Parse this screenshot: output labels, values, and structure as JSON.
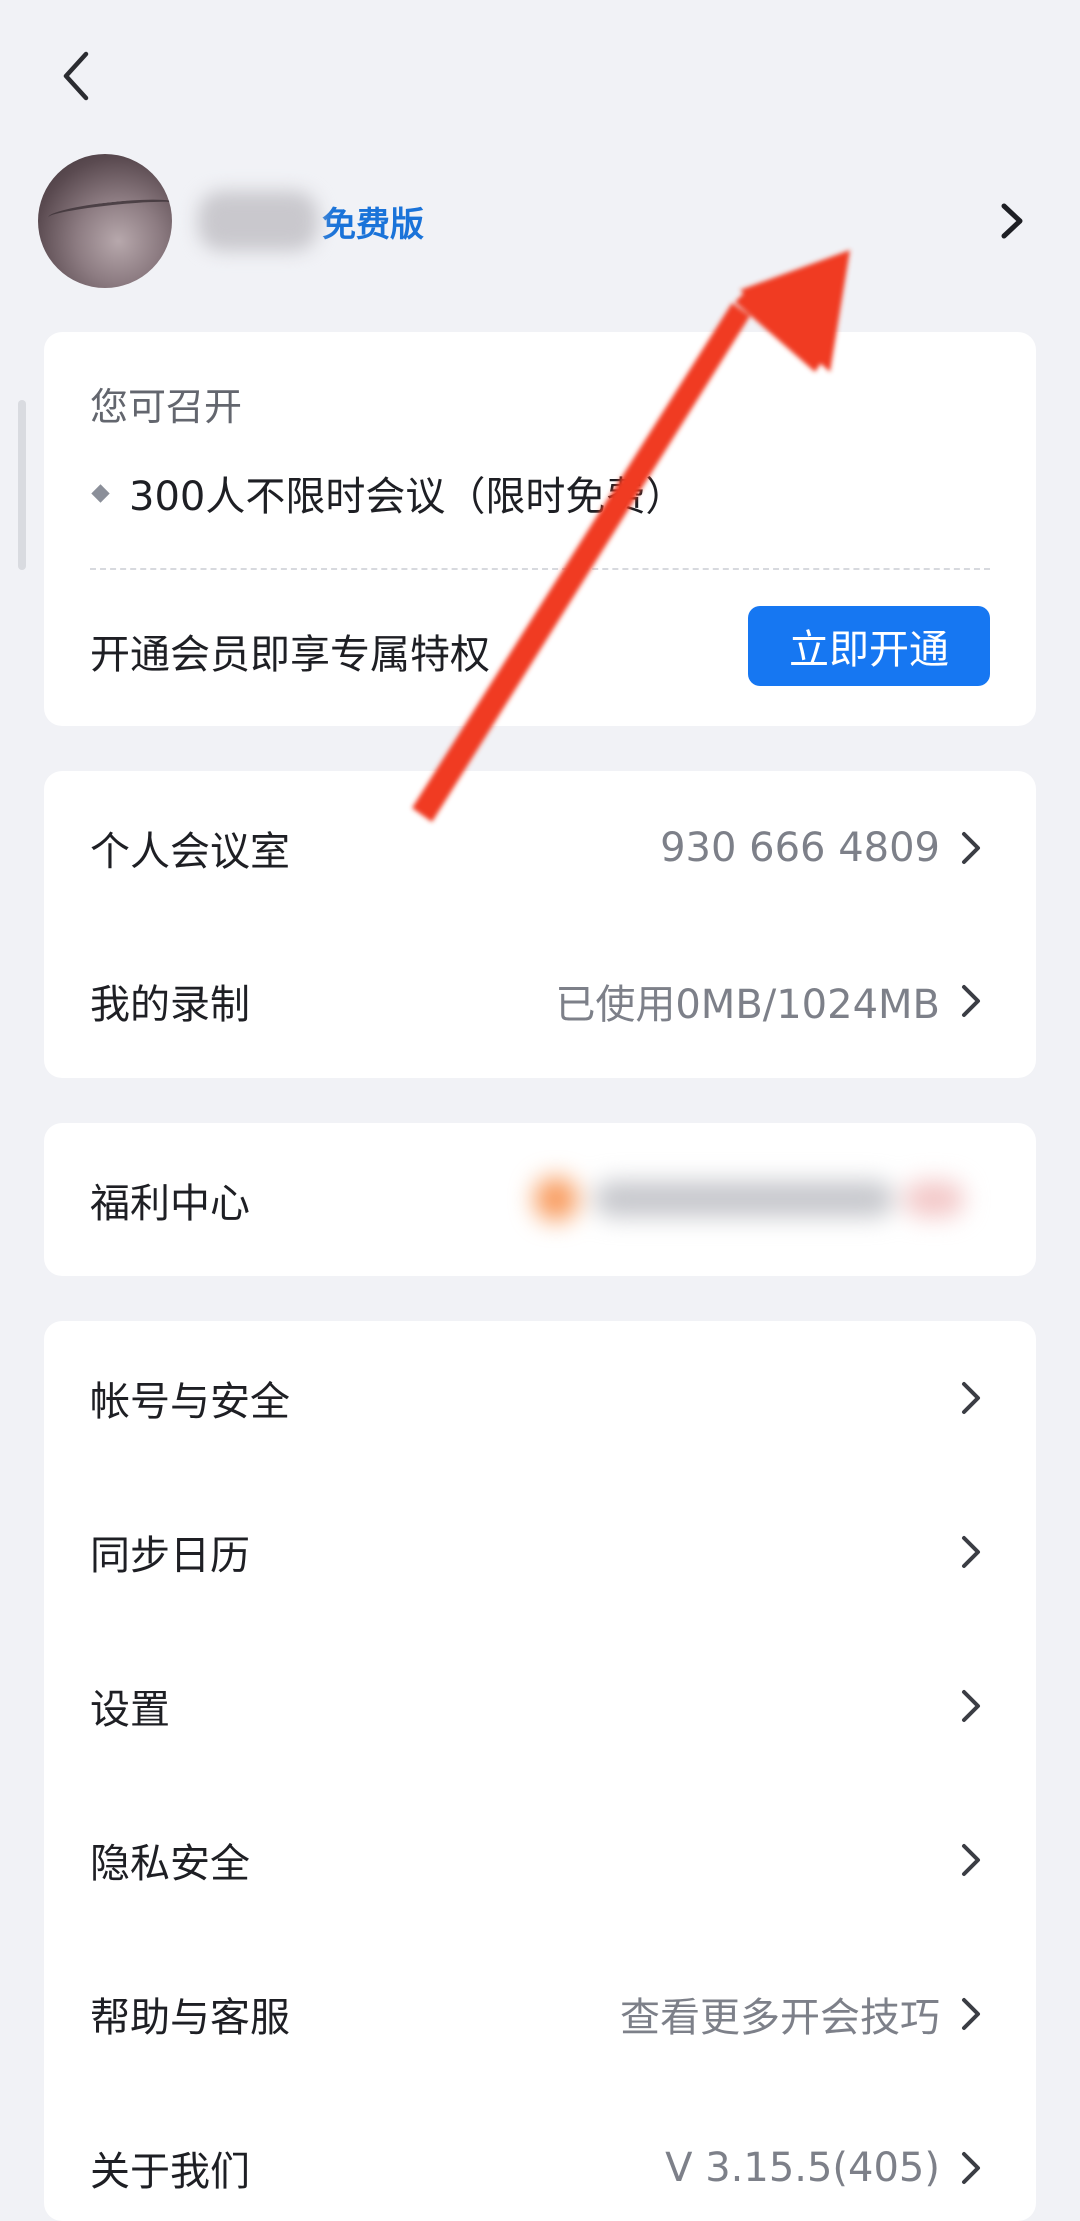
{
  "profile": {
    "username": "用户",
    "plan": "免费版"
  },
  "membership": {
    "label": "您可召开",
    "benefit": "300人不限时会议（限时免费）",
    "promo": "开通会员即享专属特权",
    "button": "立即开通"
  },
  "meeting_rows": [
    {
      "label": "个人会议室",
      "value": "930 666 4809"
    },
    {
      "label": "我的录制",
      "value": "已使用0MB/1024MB"
    }
  ],
  "welfare": {
    "label": "福利中心"
  },
  "settings_rows": [
    {
      "label": "帐号与安全",
      "value": ""
    },
    {
      "label": "同步日历",
      "value": ""
    },
    {
      "label": "设置",
      "value": ""
    },
    {
      "label": "隐私安全",
      "value": ""
    },
    {
      "label": "帮助与客服",
      "value": "查看更多开会技巧"
    },
    {
      "label": "关于我们",
      "value": "V 3.15.5(405)"
    }
  ],
  "icons": {
    "back": "chevron-left-icon",
    "row_chevron": "chevron-right-icon",
    "annotation": "red-arrow-annotation"
  },
  "colors": {
    "accent": "#1677f2",
    "plan_badge": "#1a73d9",
    "annotation_arrow": "#f03a22",
    "background": "#f1f2f6"
  }
}
